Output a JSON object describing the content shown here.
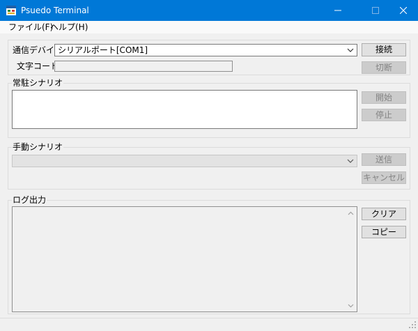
{
  "window": {
    "title": "Psuedo Terminal"
  },
  "menu": [
    "ファイル(F)",
    "ヘルプ(H)"
  ],
  "connection": {
    "device_label": "通信デバイス",
    "device_value": "シリアルポート[COM1]",
    "charcode_label": "文字コード",
    "charcode_value": "",
    "connect_label": "接続",
    "disconnect_label": "切断"
  },
  "resident": {
    "title": "常駐シナリオ",
    "start_label": "開始",
    "stop_label": "停止"
  },
  "manual": {
    "title": "手動シナリオ",
    "scenario_value": "",
    "send_label": "送信",
    "cancel_label": "キャンセル"
  },
  "log": {
    "title": "ログ出力",
    "clear_label": "クリア",
    "copy_label": "コピー"
  },
  "icons": {
    "app": "terminal-app-icon",
    "minimize": "minimize-icon",
    "maximize": "maximize-icon",
    "close": "close-icon",
    "dropdown": "chevron-down-icon",
    "scroll_up": "scroll-up-icon",
    "scroll_down": "scroll-down-icon",
    "grip": "resize-grip-icon"
  },
  "colors": {
    "titlebar": "#0078d7",
    "disabled_button": "#cccccc",
    "disabled_text": "#838383"
  }
}
